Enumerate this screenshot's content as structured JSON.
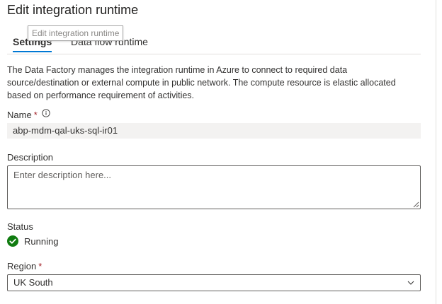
{
  "panel": {
    "title": "Edit integration runtime"
  },
  "tooltip": {
    "text": "Edit integration runtime"
  },
  "tabs": [
    {
      "label": "Settings",
      "active": true
    },
    {
      "label": "Data flow runtime",
      "active": false
    }
  ],
  "description_text": "The Data Factory manages the integration runtime in Azure to connect to required data source/destination or external compute in public network. The compute resource is elastic allocated based on performance requirement of activities.",
  "name_field": {
    "label": "Name",
    "required_mark": "*",
    "value": "abp-mdm-qal-uks-sql-ir01",
    "info_icon": "info-icon"
  },
  "description_field": {
    "label": "Description",
    "placeholder": "Enter description here..."
  },
  "status": {
    "label": "Status",
    "value": "Running",
    "icon": "check-circle-icon",
    "color": "#107c10"
  },
  "region_field": {
    "label": "Region",
    "required_mark": "*",
    "value": "UK South",
    "icon": "chevron-down-icon"
  },
  "colors": {
    "accent": "#0078d4",
    "required": "#a4262c",
    "success": "#107c10"
  }
}
